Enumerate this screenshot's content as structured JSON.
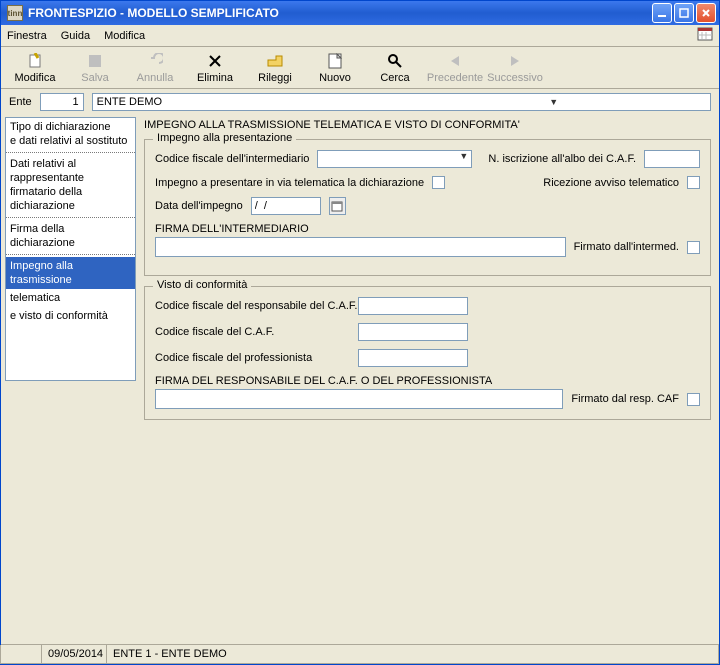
{
  "window": {
    "app_tag": "tinn",
    "title": "FRONTESPIZIO - MODELLO SEMPLIFICATO"
  },
  "menu": {
    "items": [
      "Finestra",
      "Guida",
      "Modifica"
    ]
  },
  "toolbar": {
    "modifica": "Modifica",
    "salva": "Salva",
    "annulla": "Annulla",
    "elimina": "Elimina",
    "rileggi": "Rileggi",
    "nuovo": "Nuovo",
    "cerca": "Cerca",
    "precedente": "Precedente",
    "successivo": "Successivo"
  },
  "ente": {
    "label": "Ente",
    "num": "1",
    "name": "ENTE DEMO"
  },
  "sidebar": {
    "items": [
      {
        "label": "Tipo di dichiarazione\ne dati relativi al sostituto",
        "selected": false
      },
      {
        "label": "Dati relativi al rappresentante\nfirmatario della dichiarazione",
        "selected": false
      },
      {
        "label": "Firma della dichiarazione",
        "selected": false
      },
      {
        "label": "Impegno alla trasmissione\ntelematica\ne visto di conformità",
        "selected": true
      }
    ]
  },
  "panel": {
    "title": "IMPEGNO ALLA TRASMISSIONE TELEMATICA E VISTO DI CONFORMITA'",
    "fs1": {
      "legend": "Impegno alla presentazione",
      "cf_intermediario_label": "Codice fiscale dell'intermediario",
      "iscrizione_label": "N. iscrizione all'albo dei C.A.F.",
      "impegno_telematica_label": "Impegno a presentare in via telematica la dichiarazione",
      "ricezione_label": "Ricezione avviso telematico",
      "data_impegno_label": "Data dell'impegno",
      "data_impegno_value": "/  /",
      "firma_intermediario_label": "FIRMA DELL'INTERMEDIARIO",
      "firmato_intermed_label": "Firmato dall'intermed."
    },
    "fs2": {
      "legend": "Visto di conformità",
      "cf_responsabile_label": "Codice fiscale del responsabile del C.A.F.",
      "cf_caf_label": "Codice fiscale del C.A.F.",
      "cf_prof_label": "Codice fiscale del professionista",
      "firma_resp_label": "FIRMA DEL RESPONSABILE DEL C.A.F. O DEL PROFESSIONISTA",
      "firmato_resp_label": "Firmato dal resp. CAF"
    }
  },
  "status": {
    "date": "09/05/2014",
    "text": "ENTE 1 - ENTE DEMO"
  }
}
